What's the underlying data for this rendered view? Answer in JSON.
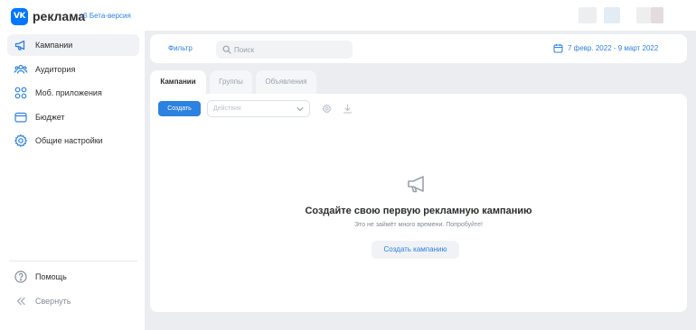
{
  "header": {
    "logo_text": "VK",
    "brand": "реклама",
    "beta_label": "β Бета-версия"
  },
  "sidebar": {
    "items": [
      {
        "label": "Кампании",
        "icon": "megaphone-icon",
        "active": true
      },
      {
        "label": "Аудитория",
        "icon": "users-icon"
      },
      {
        "label": "Моб. приложения",
        "icon": "apps-grid-icon"
      },
      {
        "label": "Бюджет",
        "icon": "wallet-icon"
      },
      {
        "label": "Общие настройки",
        "icon": "gear-icon"
      }
    ],
    "footer": [
      {
        "label": "Помощь",
        "icon": "help-icon"
      },
      {
        "label": "Свернуть",
        "icon": "collapse-icon"
      }
    ]
  },
  "filter_bar": {
    "filter_label": "Фильтр",
    "search_placeholder": "Поиск",
    "date_range": "7 февр. 2022 - 9 март 2022"
  },
  "tabs": [
    {
      "label": "Кампании",
      "active": true
    },
    {
      "label": "Группы"
    },
    {
      "label": "Объявления"
    }
  ],
  "toolbar": {
    "create_label": "Создать",
    "actions_placeholder": "Действия"
  },
  "empty_state": {
    "title": "Создайте свою первую рекламную кампанию",
    "subtitle": "Это не займёт много времени. Попробуйте!",
    "button_label": "Создать кампанию"
  },
  "colors": {
    "accent": "#2d81e0",
    "logo": "#0077ff",
    "background": "#ebedf0"
  }
}
